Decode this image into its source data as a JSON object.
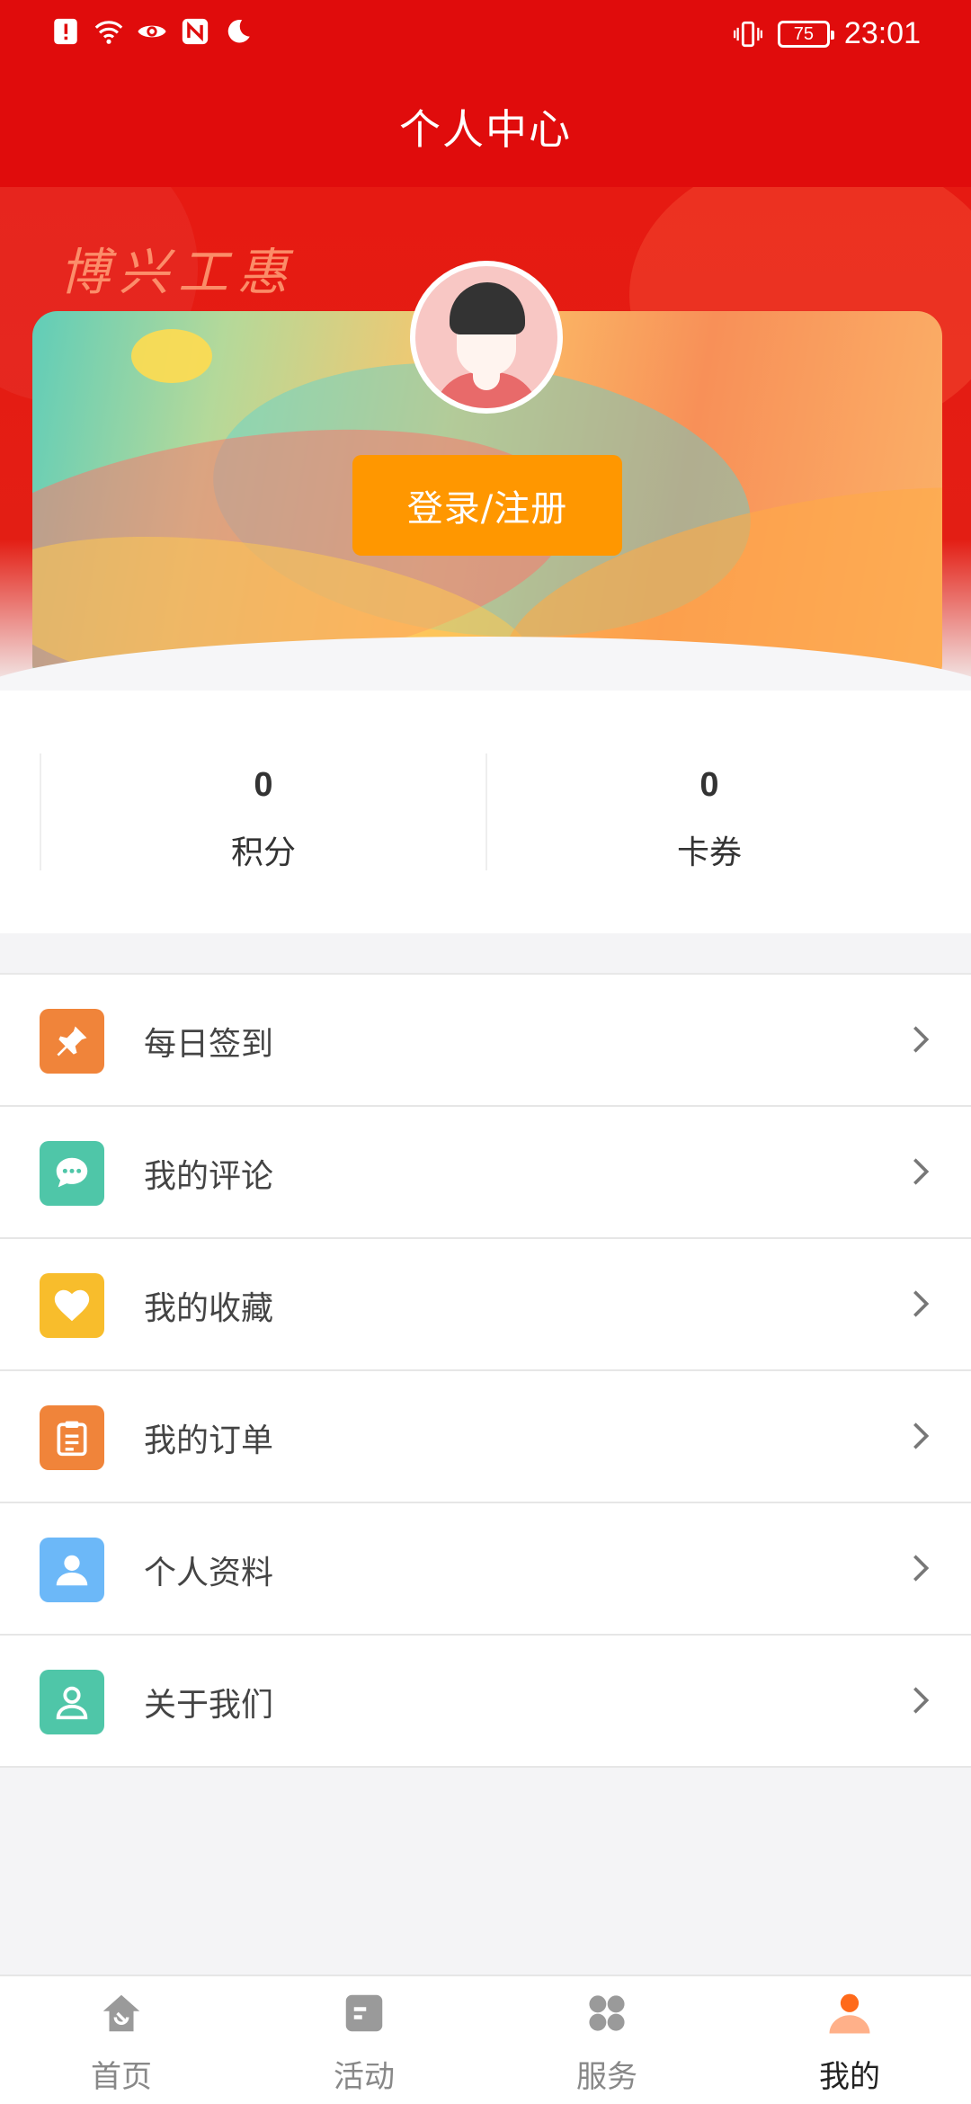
{
  "status_bar": {
    "time": "23:01",
    "battery": "75",
    "left_icons": [
      "alert-icon",
      "wifi-icon",
      "eye-icon",
      "nfc-icon",
      "moon-icon"
    ],
    "right_icons": [
      "vibrate-icon",
      "battery-icon"
    ]
  },
  "header": {
    "title": "个人中心"
  },
  "banner": {
    "calligraphy": "博兴工惠",
    "login_label": "登录/注册"
  },
  "stats": [
    {
      "value": "0",
      "label": "积分"
    },
    {
      "value": "0",
      "label": "卡券"
    }
  ],
  "menu": [
    {
      "label": "每日签到",
      "icon": "pin-icon",
      "color": "#f0843a"
    },
    {
      "label": "我的评论",
      "icon": "comment-icon",
      "color": "#4fc6a8"
    },
    {
      "label": "我的收藏",
      "icon": "heart-icon",
      "color": "#f8bd2c"
    },
    {
      "label": "我的订单",
      "icon": "clipboard-icon",
      "color": "#f0843a"
    },
    {
      "label": "个人资料",
      "icon": "user-icon",
      "color": "#6cb8f8"
    },
    {
      "label": "关于我们",
      "icon": "user-outline-icon",
      "color": "#4fc6a8"
    }
  ],
  "tabbar": [
    {
      "label": "首页",
      "icon": "home-icon",
      "active": false
    },
    {
      "label": "活动",
      "icon": "activity-icon",
      "active": false
    },
    {
      "label": "服务",
      "icon": "grid-icon",
      "active": false
    },
    {
      "label": "我的",
      "icon": "profile-icon",
      "active": true
    }
  ],
  "colors": {
    "header_red": "#e00c0c",
    "login_orange": "#ff9700",
    "active_tab_orange": "#ff6a1a"
  }
}
